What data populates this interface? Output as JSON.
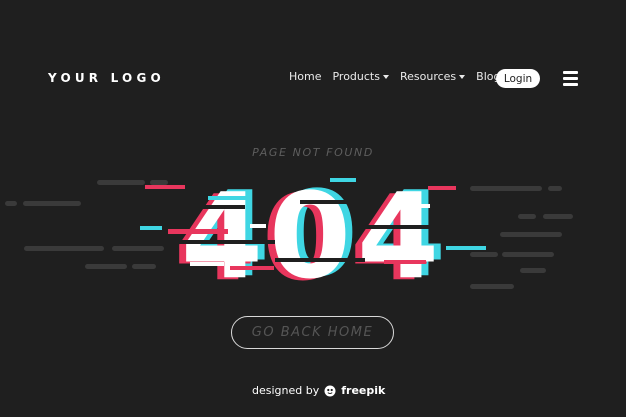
{
  "header": {
    "logo": "YOUR LOGO",
    "nav": [
      {
        "label": "Home",
        "dropdown": false
      },
      {
        "label": "Products",
        "dropdown": true
      },
      {
        "label": "Resources",
        "dropdown": true
      },
      {
        "label": "Blog",
        "dropdown": false
      }
    ],
    "login_label": "Login",
    "menu_icon": "hamburger-menu-icon"
  },
  "hero": {
    "subtitle": "PAGE NOT FOUND",
    "error_code": "404",
    "button_label": "GO BACK HOME"
  },
  "footer": {
    "credit_prefix": "designed by",
    "credit_brand": "freepik",
    "credit_icon": "freepik-logo-icon"
  },
  "colors": {
    "background": "#1f1f1f",
    "glitch_pink": "#e8365d",
    "glitch_cyan": "#3fd6e3",
    "text": "#ffffff",
    "muted": "#5e5e5e"
  }
}
